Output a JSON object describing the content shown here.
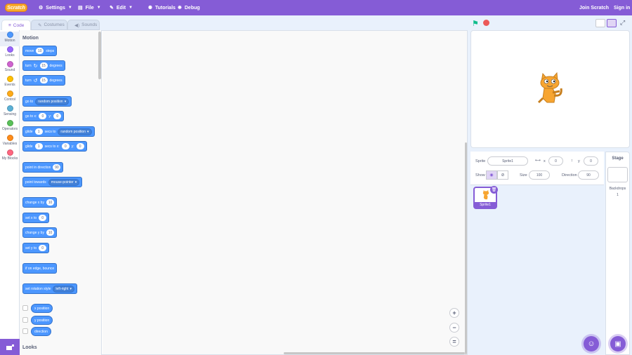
{
  "menubar": {
    "logo": "Scratch",
    "settings": "Settings",
    "file": "File",
    "edit": "Edit",
    "tutorials": "Tutorials",
    "debug": "Debug",
    "join": "Join Scratch",
    "signin": "Sign in"
  },
  "tabs": {
    "code": "Code",
    "costumes": "Costumes",
    "sounds": "Sounds"
  },
  "categories": [
    {
      "label": "Motion",
      "color": "#4c97ff"
    },
    {
      "label": "Looks",
      "color": "#9966ff"
    },
    {
      "label": "Sound",
      "color": "#cf63cf"
    },
    {
      "label": "Events",
      "color": "#ffbf00"
    },
    {
      "label": "Control",
      "color": "#ffab19"
    },
    {
      "label": "Sensing",
      "color": "#5cb1d6"
    },
    {
      "label": "Operators",
      "color": "#59c059"
    },
    {
      "label": "Variables",
      "color": "#ff8c1a"
    },
    {
      "label": "My Blocks",
      "color": "#ff6680"
    }
  ],
  "palette": {
    "motion_title": "Motion",
    "looks_title": "Looks",
    "move": {
      "a": "move",
      "v": "10",
      "b": "steps"
    },
    "turn_right": {
      "a": "turn",
      "v": "15",
      "b": "degrees"
    },
    "turn_left": {
      "a": "turn",
      "v": "15",
      "b": "degrees"
    },
    "goto": {
      "a": "go to",
      "d": "random position"
    },
    "gotoxy": {
      "a": "go to x:",
      "x": "0",
      "b": "y:",
      "y": "0"
    },
    "glide": {
      "a": "glide",
      "v": "1",
      "b": "secs to",
      "d": "random position"
    },
    "glidexy": {
      "a": "glide",
      "v": "1",
      "b": "secs to x:",
      "x": "0",
      "c": "y:",
      "y": "0"
    },
    "point_dir": {
      "a": "point in direction",
      "v": "90"
    },
    "point_towards": {
      "a": "point towards",
      "d": "mouse-pointer"
    },
    "change_x": {
      "a": "change x by",
      "v": "10"
    },
    "set_x": {
      "a": "set x to",
      "v": "0"
    },
    "change_y": {
      "a": "change y by",
      "v": "10"
    },
    "set_y": {
      "a": "set y to",
      "v": "0"
    },
    "bounce": "if on edge, bounce",
    "rotation": {
      "a": "set rotation style",
      "d": "left-right"
    },
    "xpos": "x position",
    "ypos": "y position",
    "direction": "direction"
  },
  "zoom": {
    "in": "+",
    "out": "−",
    "reset": "="
  },
  "sprite_info": {
    "sprite_label": "Sprite",
    "sprite_name": "Sprite1",
    "x_label": "x",
    "x_value": "0",
    "y_label": "y",
    "y_value": "0",
    "show_label": "Show",
    "size_label": "Size",
    "size_value": "100",
    "direction_label": "Direction",
    "direction_value": "90"
  },
  "sprite_list": [
    {
      "name": "Sprite1",
      "selected": true
    }
  ],
  "stage_panel": {
    "title": "Stage",
    "backdrops_label": "Backdrops",
    "backdrops_count": "1"
  },
  "colors": {
    "accent": "#855cd6",
    "motion": "#4c97ff"
  }
}
